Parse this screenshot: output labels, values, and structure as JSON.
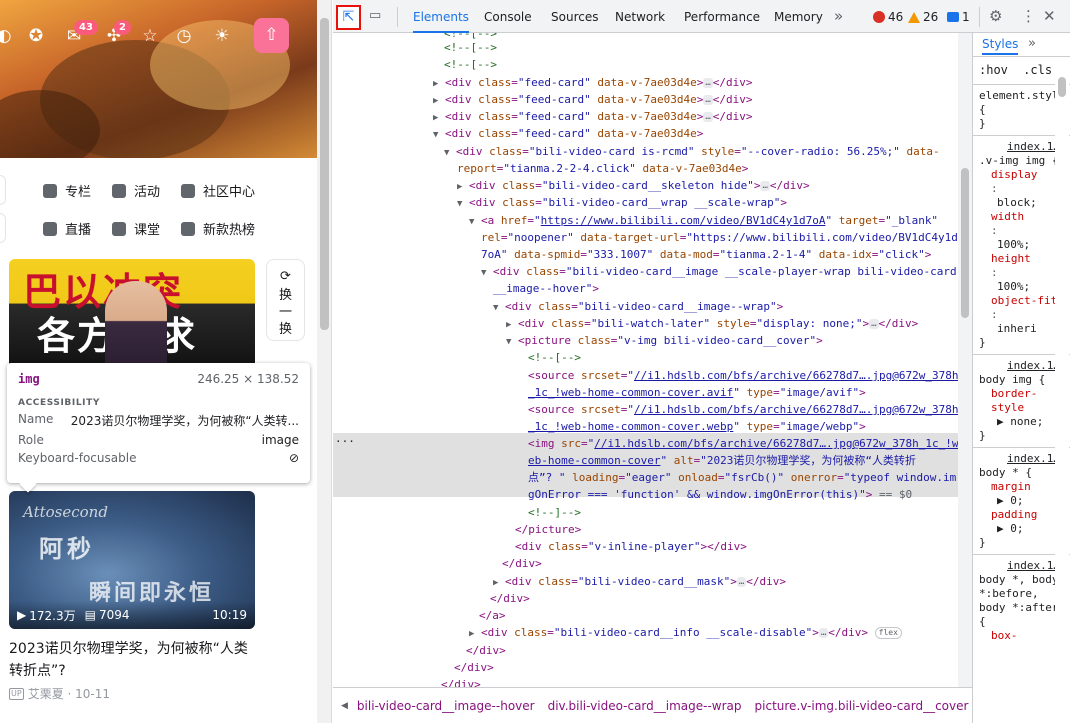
{
  "site": {
    "topbar": {
      "message_badge": "43",
      "dynamic_badge": "2"
    },
    "nav": {
      "row1": [
        "专栏",
        "活动",
        "社区中心"
      ],
      "row2": [
        "直播",
        "课堂",
        "新款热榜"
      ]
    },
    "card1": {
      "line1": "巴以冲突",
      "line2": "各方诉求"
    },
    "refresh_label": "换一换",
    "card2": {
      "overlay_top": "Attosecond",
      "overlay_mid": "阿秒",
      "overlay_bot": "瞬间即永恒",
      "views": "172.3万",
      "danmaku": "7094",
      "duration": "10:19"
    },
    "video_title": "2023诺贝尔物理学奖，为何被称“人类转折点”?",
    "video_author": "艾栗夏 · 10-11",
    "up_tag": "UP"
  },
  "tooltip": {
    "tag": "img",
    "size": "246.25 × 138.52",
    "section": "ACCESSIBILITY",
    "name_label": "Name",
    "name_value": "2023诺贝尔物理学奖，为何被称“人类转...",
    "role_label": "Role",
    "role_value": "image",
    "focus_label": "Keyboard-focusable"
  },
  "devtools": {
    "tabs": [
      "Elements",
      "Console",
      "Sources",
      "Network",
      "Performance",
      "Memory"
    ],
    "active_tab": "Elements",
    "errors": "46",
    "warnings": "26",
    "messages": "1",
    "lines": [
      "<!--[-->",
      "<!--[-->",
      "<!--[-->",
      "<div class=\"feed-card\" data-v-7ae03d4e>",
      "<div class=\"feed-card\" data-v-7ae03d4e>",
      "<div class=\"feed-card\" data-v-7ae03d4e>",
      "<div class=\"feed-card\" data-v-7ae03d4e>"
    ],
    "breadcrumbs": [
      "bili-video-card__image--hover",
      "div.bili-video-card__image--wrap",
      "picture.v-img.bili-video-card__cover",
      "img"
    ]
  },
  "styles_panel": {
    "tab": "Styles",
    "filter_hov": ":hov",
    "filter_cls": ".cls",
    "element_style": "element.style {",
    "close": "}",
    "rules": [
      {
        "source": "index.1…",
        "selector": ".v-img img {",
        "props": [
          [
            "display",
            "block;"
          ],
          [
            "width",
            "100%;"
          ],
          [
            "height",
            "100%;"
          ],
          [
            "object-fit",
            "inheri"
          ]
        ]
      },
      {
        "source": "index.1…",
        "selector": "body img {",
        "props": [
          [
            "border-style",
            "▶ none;"
          ]
        ]
      },
      {
        "source": "index.1…",
        "selector": "body * {",
        "props": [
          [
            "margin",
            "▶ 0;"
          ],
          [
            "padding",
            "▶ 0;"
          ]
        ]
      },
      {
        "source": "index.1…",
        "selector": "body *, body *:before, body *:after {",
        "props": [
          [
            "box-",
            ""
          ]
        ]
      }
    ]
  }
}
